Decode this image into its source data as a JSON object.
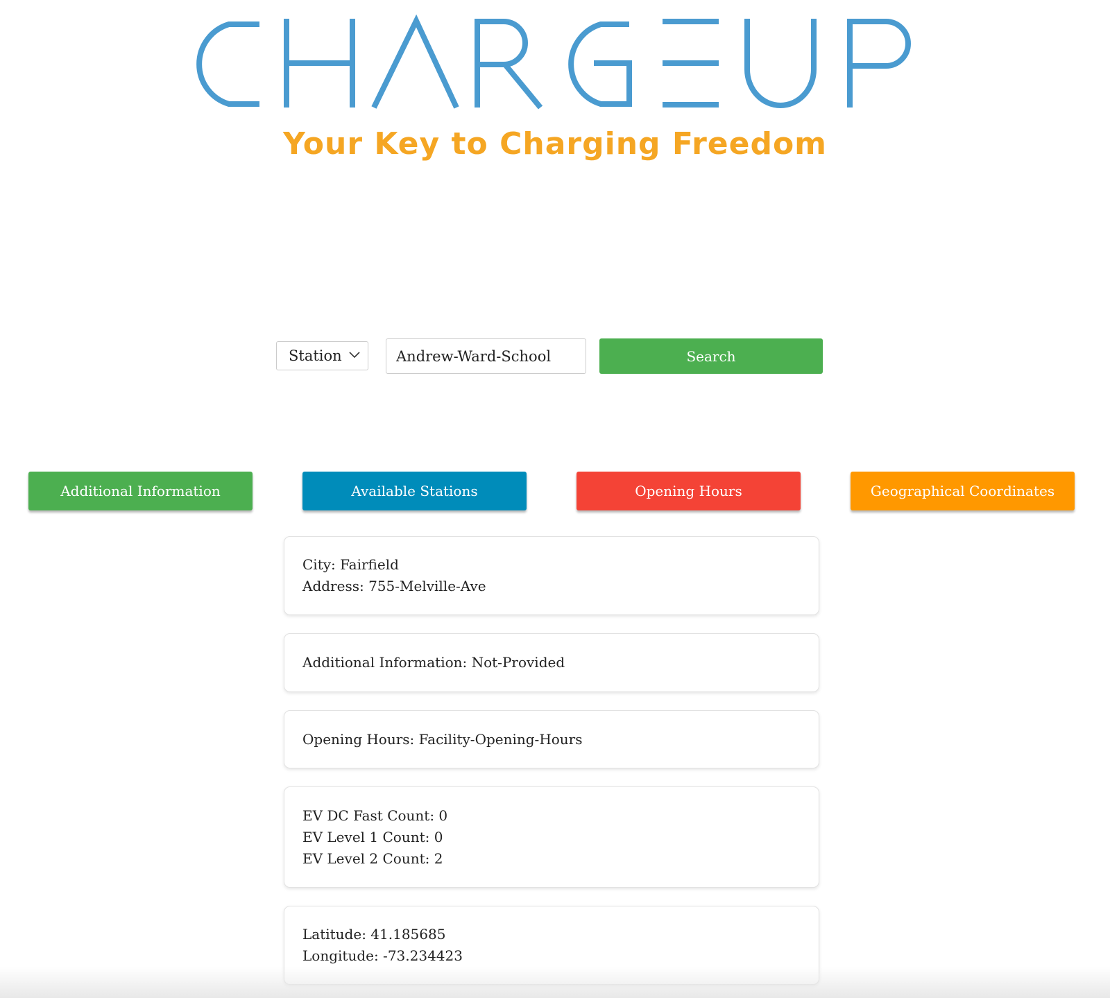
{
  "brand": {
    "logo_text": "CHARGEUP",
    "tagline": "Your Key to Charging Freedom",
    "logo_color": "#4A9BD0",
    "tagline_color": "#F5A623"
  },
  "search": {
    "type_select_value": "Station",
    "query_value": "Andrew-Ward-School",
    "button_label": "Search"
  },
  "tabs": [
    {
      "label": "Additional Information",
      "color": "#4CAF50"
    },
    {
      "label": "Available Stations",
      "color": "#008CBA"
    },
    {
      "label": "Opening Hours",
      "color": "#F44336"
    },
    {
      "label": "Geographical Coordinates",
      "color": "#FF9800"
    }
  ],
  "details": {
    "city": "City: Fairfield",
    "address": "Address: 755-Melville-Ave",
    "additional_info": "Additional Information: Not-Provided",
    "opening_hours": "Opening Hours: Facility-Opening-Hours",
    "ev_dc_fast": "EV DC Fast Count: 0",
    "ev_level1": "EV Level 1 Count: 0",
    "ev_level2": "EV Level 2 Count: 2",
    "latitude": "Latitude: 41.185685",
    "longitude": "Longitude: -73.234423"
  }
}
